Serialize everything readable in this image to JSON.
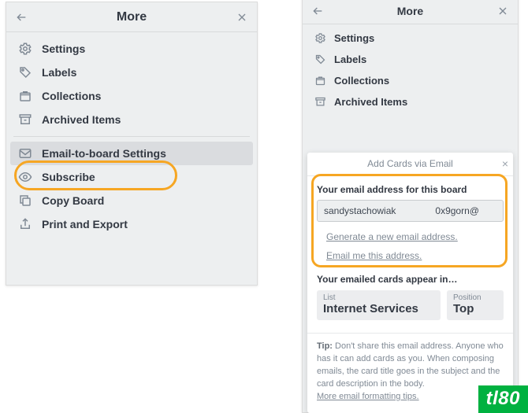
{
  "left_panel": {
    "title": "More",
    "items": [
      {
        "key": "settings",
        "label": "Settings",
        "icon": "gear-icon"
      },
      {
        "key": "labels",
        "label": "Labels",
        "icon": "tag-icon"
      },
      {
        "key": "collections",
        "label": "Collections",
        "icon": "box-icon"
      },
      {
        "key": "archived",
        "label": "Archived Items",
        "icon": "archive-icon"
      },
      {
        "divider": true
      },
      {
        "key": "email",
        "label": "Email-to-board Settings",
        "icon": "mail-icon",
        "highlight": true
      },
      {
        "key": "subscribe",
        "label": "Subscribe",
        "icon": "eye-icon"
      },
      {
        "key": "copy",
        "label": "Copy Board",
        "icon": "copy-icon"
      },
      {
        "key": "print",
        "label": "Print and Export",
        "icon": "share-icon"
      }
    ]
  },
  "right_panel": {
    "title": "More",
    "items": [
      {
        "key": "settings",
        "label": "Settings",
        "icon": "gear-icon"
      },
      {
        "key": "labels",
        "label": "Labels",
        "icon": "tag-icon"
      },
      {
        "key": "collections",
        "label": "Collections",
        "icon": "box-icon"
      },
      {
        "key": "archived",
        "label": "Archived Items",
        "icon": "archive-icon"
      }
    ]
  },
  "card": {
    "header": "Add Cards via Email",
    "body": {
      "email_label": "Your email address for this board",
      "email_value": "sandystachowiak               0x9gorn@",
      "generate_link": "Generate a new email address.",
      "email_me_link": "Email me this address.",
      "appear_label": "Your emailed cards appear in…",
      "list": {
        "label": "List",
        "value": "Internet Services"
      },
      "position": {
        "label": "Position",
        "value": "Top"
      }
    },
    "footer": {
      "tip_label": "Tip:",
      "tip_text": "Don't share this email address. Anyone who has it can add cards as you. When composing emails, the card title goes in the subject and the card description in the body.",
      "tips_link": "More email formatting tips."
    }
  },
  "badge": "tl80"
}
